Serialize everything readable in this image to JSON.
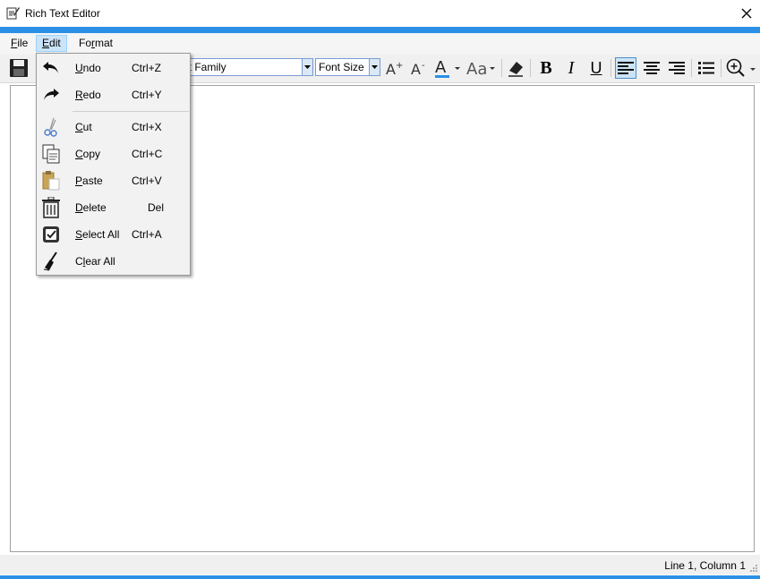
{
  "window": {
    "title": "Rich Text Editor",
    "icon": "notepad-pencil-icon",
    "close_icon": "close-icon"
  },
  "menubar": {
    "items": [
      {
        "label": "File"
      },
      {
        "label": "Edit"
      },
      {
        "label": "Format"
      }
    ]
  },
  "toolbar": {
    "font_family_placeholder": "Font Family",
    "font_family_visible": "nt Family",
    "font_size_placeholder": "Font Size",
    "icons": [
      "save-icon",
      "grow-font-icon",
      "shrink-font-icon",
      "font-color-icon",
      "change-case-icon",
      "eraser-icon",
      "bold-icon",
      "italic-icon",
      "underline-icon",
      "align-left-icon",
      "align-center-icon",
      "align-right-icon",
      "bullet-list-icon",
      "zoom-icon"
    ],
    "bold_glyph": "B",
    "italic_glyph": "I",
    "underline_glyph": "U"
  },
  "edit_menu": {
    "items": [
      {
        "label": "Undo",
        "mnemonic": "U",
        "rest": "ndo",
        "shortcut": "Ctrl+Z",
        "icon": "undo-icon"
      },
      {
        "label": "Redo",
        "mnemonic": "R",
        "rest": "edo",
        "shortcut": "Ctrl+Y",
        "icon": "redo-icon"
      },
      {
        "label": "Cut",
        "mnemonic": "C",
        "rest": "ut",
        "shortcut": "Ctrl+X",
        "icon": "scissors-icon"
      },
      {
        "label": "Copy",
        "mnemonic": "C",
        "rest": "opy",
        "shortcut": "Ctrl+C",
        "icon": "copy-icon"
      },
      {
        "label": "Paste",
        "mnemonic": "P",
        "rest": "aste",
        "shortcut": "Ctrl+V",
        "icon": "paste-icon"
      },
      {
        "label": "Delete",
        "mnemonic": "D",
        "rest": "elete",
        "shortcut": "Del",
        "icon": "trash-icon"
      },
      {
        "label": "Select All",
        "mnemonic": "S",
        "rest": "elect All",
        "shortcut": "Ctrl+A",
        "icon": "select-all-icon"
      },
      {
        "label": "Clear All",
        "pre": "C",
        "mnemonic": "l",
        "rest": "ear All",
        "shortcut": "",
        "icon": "broom-icon"
      }
    ]
  },
  "status": {
    "position": "Line 1, Column 1"
  },
  "colors": {
    "accent": "#2b90e6",
    "menu_highlight": "#cce4f7"
  }
}
